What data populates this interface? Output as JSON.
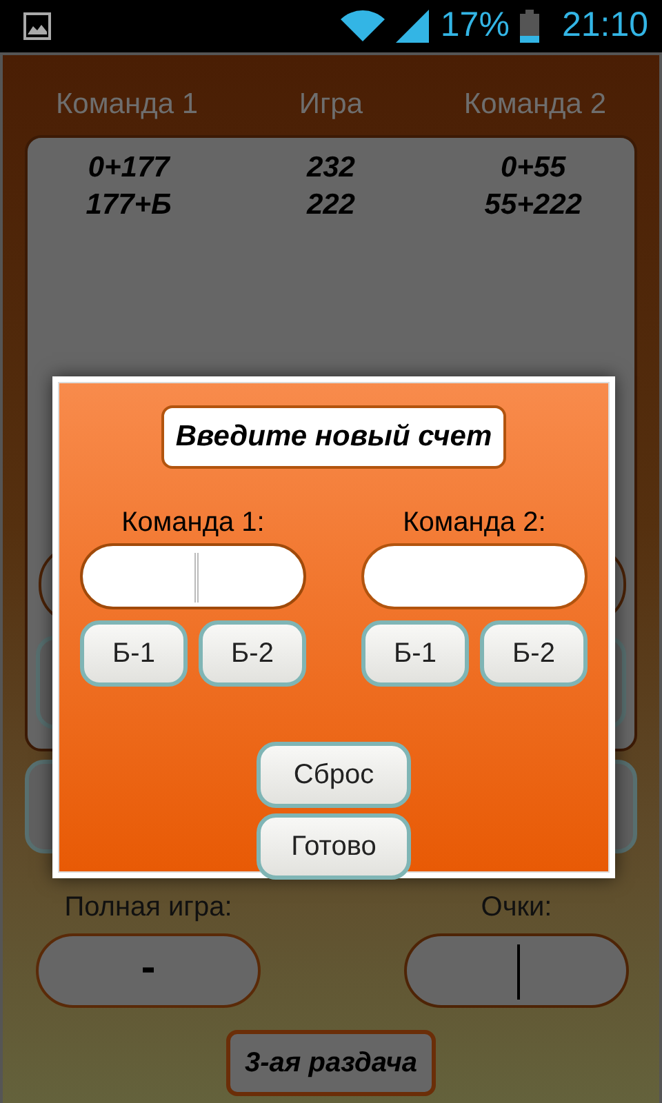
{
  "status_bar": {
    "battery": "17%",
    "time": "21:10"
  },
  "score_table": {
    "columns": [
      "Команда 1",
      "Игра",
      "Команда 2"
    ],
    "rows": [
      [
        "0+177",
        "232",
        "0+55"
      ],
      [
        "177+Б",
        "222",
        "55+222"
      ]
    ]
  },
  "dialog": {
    "title": "Введите новый счет",
    "teams": [
      {
        "label": "Команда 1:",
        "focused": true,
        "buttons": [
          "Б-1",
          "Б-2"
        ]
      },
      {
        "label": "Команда 2:",
        "focused": false,
        "buttons": [
          "Б-1",
          "Б-2"
        ]
      }
    ],
    "actions": [
      "Сброс",
      "Готово"
    ]
  },
  "bottom": {
    "fields": [
      {
        "label": "Полная игра:",
        "value": "-",
        "focused": false
      },
      {
        "label": "Очки:",
        "focused": true
      }
    ],
    "button": "3-ая раздача"
  }
}
